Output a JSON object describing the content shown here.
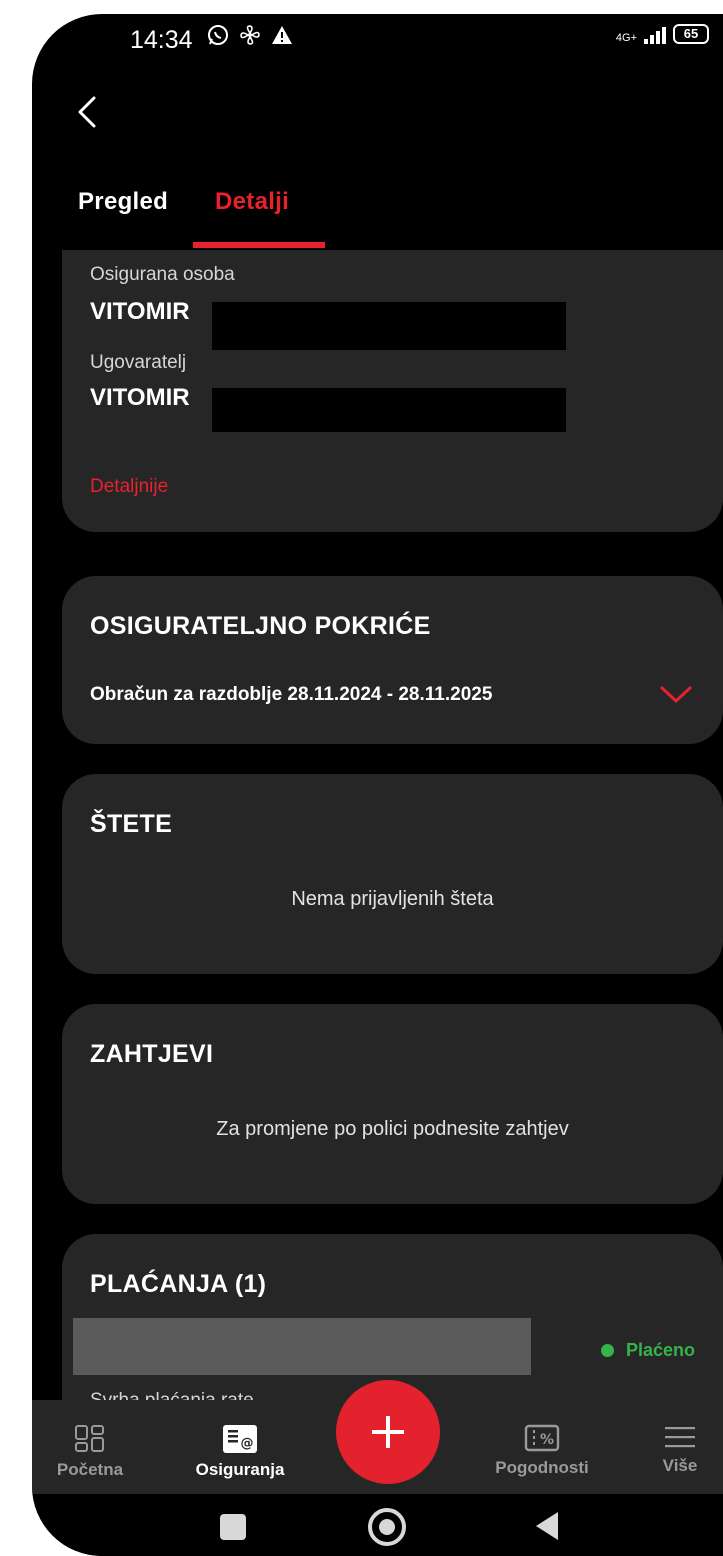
{
  "status_bar": {
    "time": "14:34",
    "network": "4G+",
    "battery": "65"
  },
  "tabs": [
    {
      "label": "Pregled",
      "active": false
    },
    {
      "label": "Detalji",
      "active": true
    }
  ],
  "policy_card": {
    "insured_label": "Osigurana osoba",
    "insured_value": "VITOMIR",
    "contractor_label": "Ugovaratelj",
    "contractor_value": "VITOMIR",
    "details_link": "Detaljnije"
  },
  "coverage_card": {
    "title": "OSIGURATELJNO POKRIĆE",
    "period": "Obračun za razdoblje 28.11.2024 - 28.11.2025"
  },
  "claims_card": {
    "title": "ŠTETE",
    "empty_text": "Nema prijavljenih šteta"
  },
  "requests_card": {
    "title": "ZAHTJEVI",
    "text": "Za promjene po polici podnesite zahtjev"
  },
  "payments_card": {
    "title": "PLAĆANJA (1)",
    "status": "Plaćeno",
    "purpose_label": "Svrha plaćanja rate"
  },
  "bottom_nav": [
    {
      "label": "Početna",
      "icon": "grid-icon",
      "active": false
    },
    {
      "label": "Osiguranja",
      "icon": "document-mail-icon",
      "active": true
    },
    {
      "label": "Pogodnosti",
      "icon": "discount-ticket-icon",
      "active": false
    },
    {
      "label": "Više",
      "icon": "hamburger-menu-icon",
      "active": false
    }
  ],
  "colors": {
    "accent": "#e8212e",
    "card": "#262626",
    "background": "#000000",
    "status_green": "#36b34a"
  }
}
